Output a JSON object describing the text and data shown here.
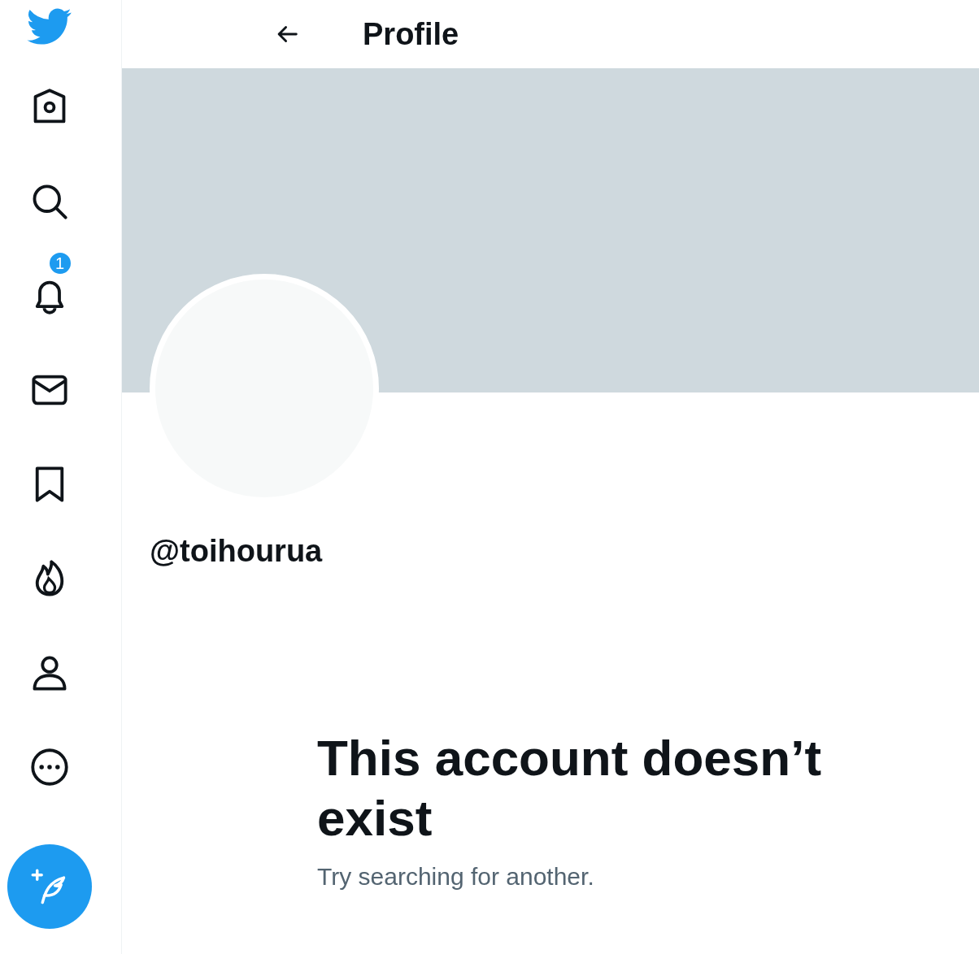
{
  "sidebar": {
    "items": [
      {
        "kind": "home"
      },
      {
        "kind": "search"
      },
      {
        "kind": "notifications",
        "badge": "1"
      },
      {
        "kind": "messages"
      },
      {
        "kind": "bookmarks"
      },
      {
        "kind": "trending"
      },
      {
        "kind": "profile"
      },
      {
        "kind": "more"
      }
    ]
  },
  "header": {
    "title": "Profile"
  },
  "profile": {
    "handle": "@toihourua"
  },
  "empty_state": {
    "title": "This account doesn’t exist",
    "subtitle": "Try searching for another."
  }
}
